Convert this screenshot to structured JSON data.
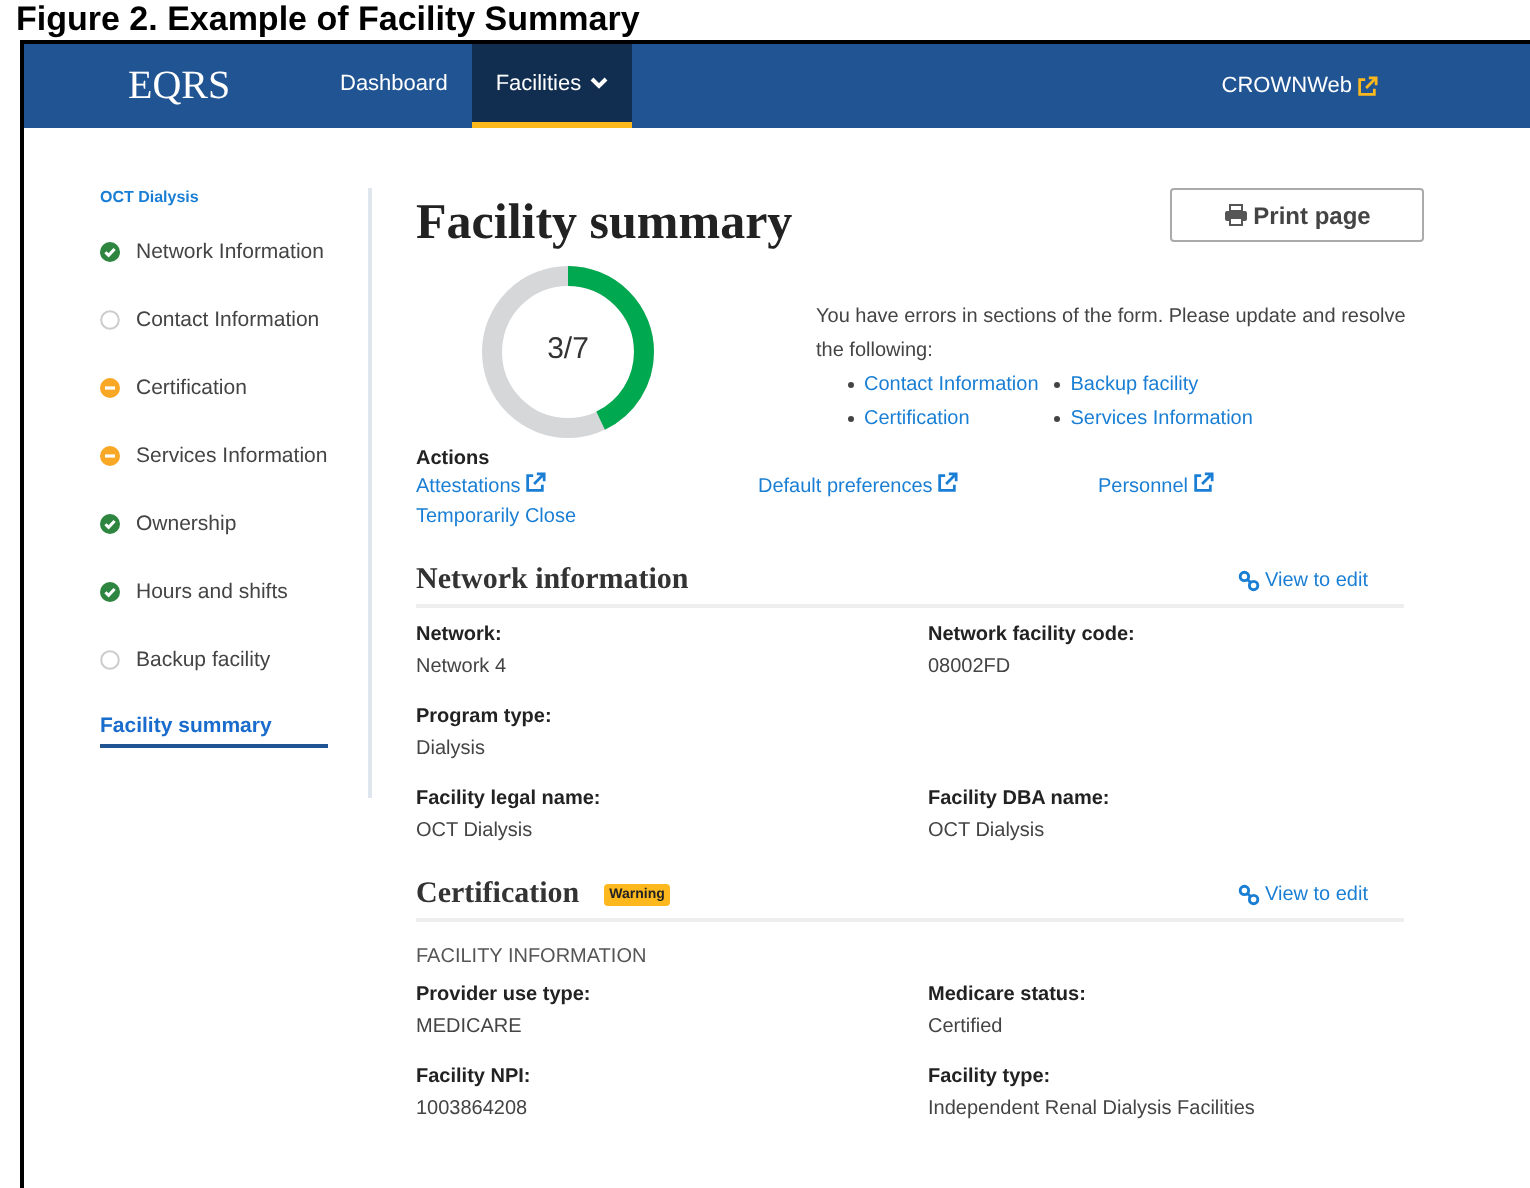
{
  "caption": "Figure 2. Example of Facility Summary",
  "nav": {
    "logo": "EQRS",
    "items": [
      {
        "label": "Dashboard",
        "selected": false,
        "dropdown": false
      },
      {
        "label": "Facilities",
        "selected": true,
        "dropdown": true
      }
    ],
    "external": "CROWNWeb"
  },
  "sidebar": {
    "title": "OCT Dialysis",
    "items": [
      {
        "label": "Network Information",
        "kind": "complete",
        "selected": false
      },
      {
        "label": "Contact Information",
        "kind": "empty",
        "selected": false
      },
      {
        "label": "Certification",
        "kind": "warning",
        "selected": false
      },
      {
        "label": "Services Information",
        "kind": "warning",
        "selected": false
      },
      {
        "label": "Ownership",
        "kind": "complete",
        "selected": false
      },
      {
        "label": "Hours and shifts",
        "kind": "complete",
        "selected": false
      },
      {
        "label": "Backup facility",
        "kind": "empty",
        "selected": false
      },
      {
        "label": "Facility summary",
        "selected": true
      }
    ]
  },
  "title": "Facility summary",
  "print_button": "Print page",
  "progress": {
    "text": "3/7",
    "level": 0.4286
  },
  "errors": {
    "message": "You have errors in sections of the form. Please update and resolve the following:",
    "links": [
      "Contact Information",
      "Backup facility",
      "Certification",
      "Services Information"
    ]
  },
  "actions": {
    "title": "Actions",
    "links": [
      {
        "label": "Attestations",
        "external": true
      },
      {
        "label": "Default preferences",
        "external": true
      },
      {
        "label": "Personnel",
        "external": true
      },
      {
        "label": "Temporarily Close",
        "external": false
      }
    ]
  },
  "sections": [
    {
      "title": "Network information",
      "edit": "View to edit",
      "rows": [
        [
          {
            "label": "Network:",
            "value": "Network 4"
          },
          {
            "label": "Network facility code:",
            "value": "08002FD"
          }
        ],
        [
          {
            "label": "Program type:",
            "value": "Dialysis"
          }
        ],
        [
          {
            "label": "Facility legal name:",
            "value": "OCT Dialysis"
          },
          {
            "label": "Facility DBA name:",
            "value": "OCT Dialysis"
          }
        ]
      ]
    },
    {
      "title": "Certification",
      "badge": "Warning",
      "edit": "View to edit",
      "subheading": "FACILITY INFORMATION",
      "rows": [
        [
          {
            "label": "Provider use type:",
            "value": "MEDICARE"
          },
          {
            "label": "Medicare status:",
            "value": "Certified"
          }
        ],
        [
          {
            "label": "Facility NPI:",
            "value": "1003864208"
          },
          {
            "label": "Facility type:",
            "value": "Independent Renal Dialysis Facilities"
          }
        ]
      ]
    }
  ]
}
